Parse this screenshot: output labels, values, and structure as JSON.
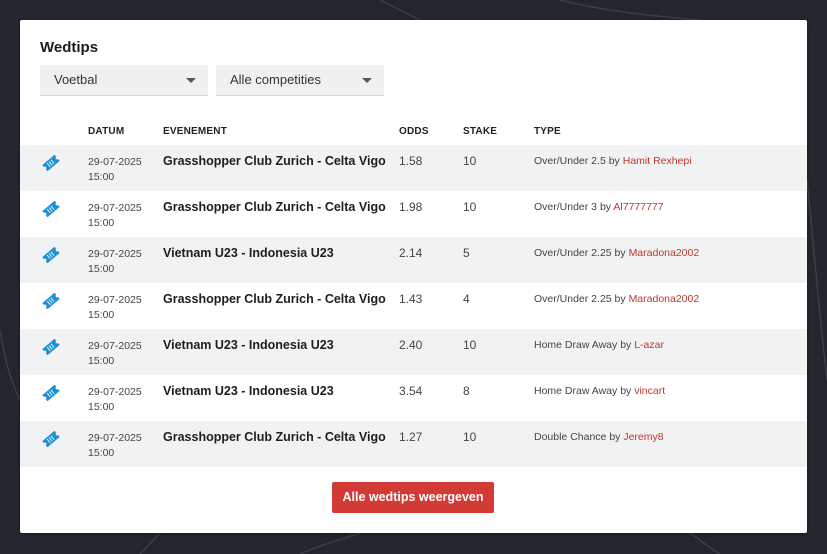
{
  "widget": {
    "title": "Wedtips",
    "sport_filter": "Voetbal",
    "competition_filter": "Alle competities",
    "show_all_label": "Alle wedtips weergeven"
  },
  "colors": {
    "accent": "#d23b35",
    "ticket_icon": "#1f8fd3",
    "username": "#c0392b",
    "page_bg": "#23262e"
  },
  "table": {
    "headers": {
      "date": "DATUM",
      "event": "EVENEMENT",
      "odds": "ODDS",
      "stake": "STAKE",
      "type": "TYPE"
    },
    "by_word": "by",
    "rows": [
      {
        "date": "29-07-2025",
        "time": "15:00",
        "event": "Grasshopper Club Zurich - Celta Vigo",
        "odds": "1.58",
        "stake": "10",
        "type": "Over/Under 2.5",
        "user": "Hamit Rexhepi"
      },
      {
        "date": "29-07-2025",
        "time": "15:00",
        "event": "Grasshopper Club Zurich - Celta Vigo",
        "odds": "1.98",
        "stake": "10",
        "type": "Over/Under 3",
        "user": "Al7777777"
      },
      {
        "date": "29-07-2025",
        "time": "15:00",
        "event": "Vietnam U23 - Indonesia U23",
        "odds": "2.14",
        "stake": "5",
        "type": "Over/Under 2.25",
        "user": "Maradona2002"
      },
      {
        "date": "29-07-2025",
        "time": "15:00",
        "event": "Grasshopper Club Zurich - Celta Vigo",
        "odds": "1.43",
        "stake": "4",
        "type": "Over/Under 2.25",
        "user": "Maradona2002"
      },
      {
        "date": "29-07-2025",
        "time": "15:00",
        "event": "Vietnam U23 - Indonesia U23",
        "odds": "2.40",
        "stake": "10",
        "type": "Home Draw Away",
        "user": "L-azar"
      },
      {
        "date": "29-07-2025",
        "time": "15:00",
        "event": "Vietnam U23 - Indonesia U23",
        "odds": "3.54",
        "stake": "8",
        "type": "Home Draw Away",
        "user": "vincart"
      },
      {
        "date": "29-07-2025",
        "time": "15:00",
        "event": "Grasshopper Club Zurich - Celta Vigo",
        "odds": "1.27",
        "stake": "10",
        "type": "Double Chance",
        "user": "Jeremy8"
      }
    ]
  }
}
